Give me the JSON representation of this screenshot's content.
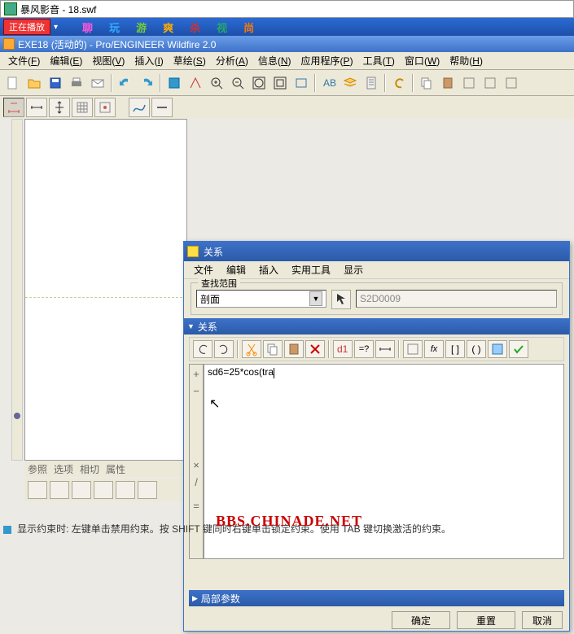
{
  "outer_window": {
    "title": "暴风影音 - 18.swf"
  },
  "player_bar": {
    "now_playing": "正在播放",
    "links": [
      {
        "label": "聊",
        "color": "#f5d"
      },
      {
        "label": "玩",
        "color": "#3af"
      },
      {
        "label": "游",
        "color": "#7c3"
      },
      {
        "label": "爽",
        "color": "#fa0"
      },
      {
        "label": "杀",
        "color": "#c33"
      },
      {
        "label": "视",
        "color": "#2a6"
      },
      {
        "label": "尚",
        "color": "#f70"
      }
    ]
  },
  "inner_window": {
    "title": "EXE18 (活动的) - Pro/ENGINEER Wildfire 2.0"
  },
  "main_menu": [
    {
      "label": "文件",
      "key": "F"
    },
    {
      "label": "编辑",
      "key": "E"
    },
    {
      "label": "视图",
      "key": "V"
    },
    {
      "label": "插入",
      "key": "I"
    },
    {
      "label": "草绘",
      "key": "S"
    },
    {
      "label": "分析",
      "key": "A"
    },
    {
      "label": "信息",
      "key": "N"
    },
    {
      "label": "应用程序",
      "key": "P"
    },
    {
      "label": "工具",
      "key": "T"
    },
    {
      "label": "窗口",
      "key": "W"
    },
    {
      "label": "帮助",
      "key": "H"
    }
  ],
  "bottom_tabs": [
    "参照",
    "选项",
    "相切",
    "属性"
  ],
  "dialog": {
    "title": "关系",
    "menu": [
      "文件",
      "编辑",
      "插入",
      "实用工具",
      "显示"
    ],
    "search_group_label": "查找范围",
    "combo_value": "剖面",
    "id_field": "S2D0009",
    "section_header": "关系",
    "editor_text": "sd6=25*cos(tra",
    "local_params_header": "局部参数",
    "buttons": {
      "ok": "确定",
      "reset": "重置",
      "cancel": "取消"
    }
  },
  "watermark": "BBS.CHINADE.NET",
  "status_text": "显示约束时: 左键单击禁用约束。按 SHIFT 键同时右键单击锁定约束。使用 TAB 键切换激活的约束。"
}
